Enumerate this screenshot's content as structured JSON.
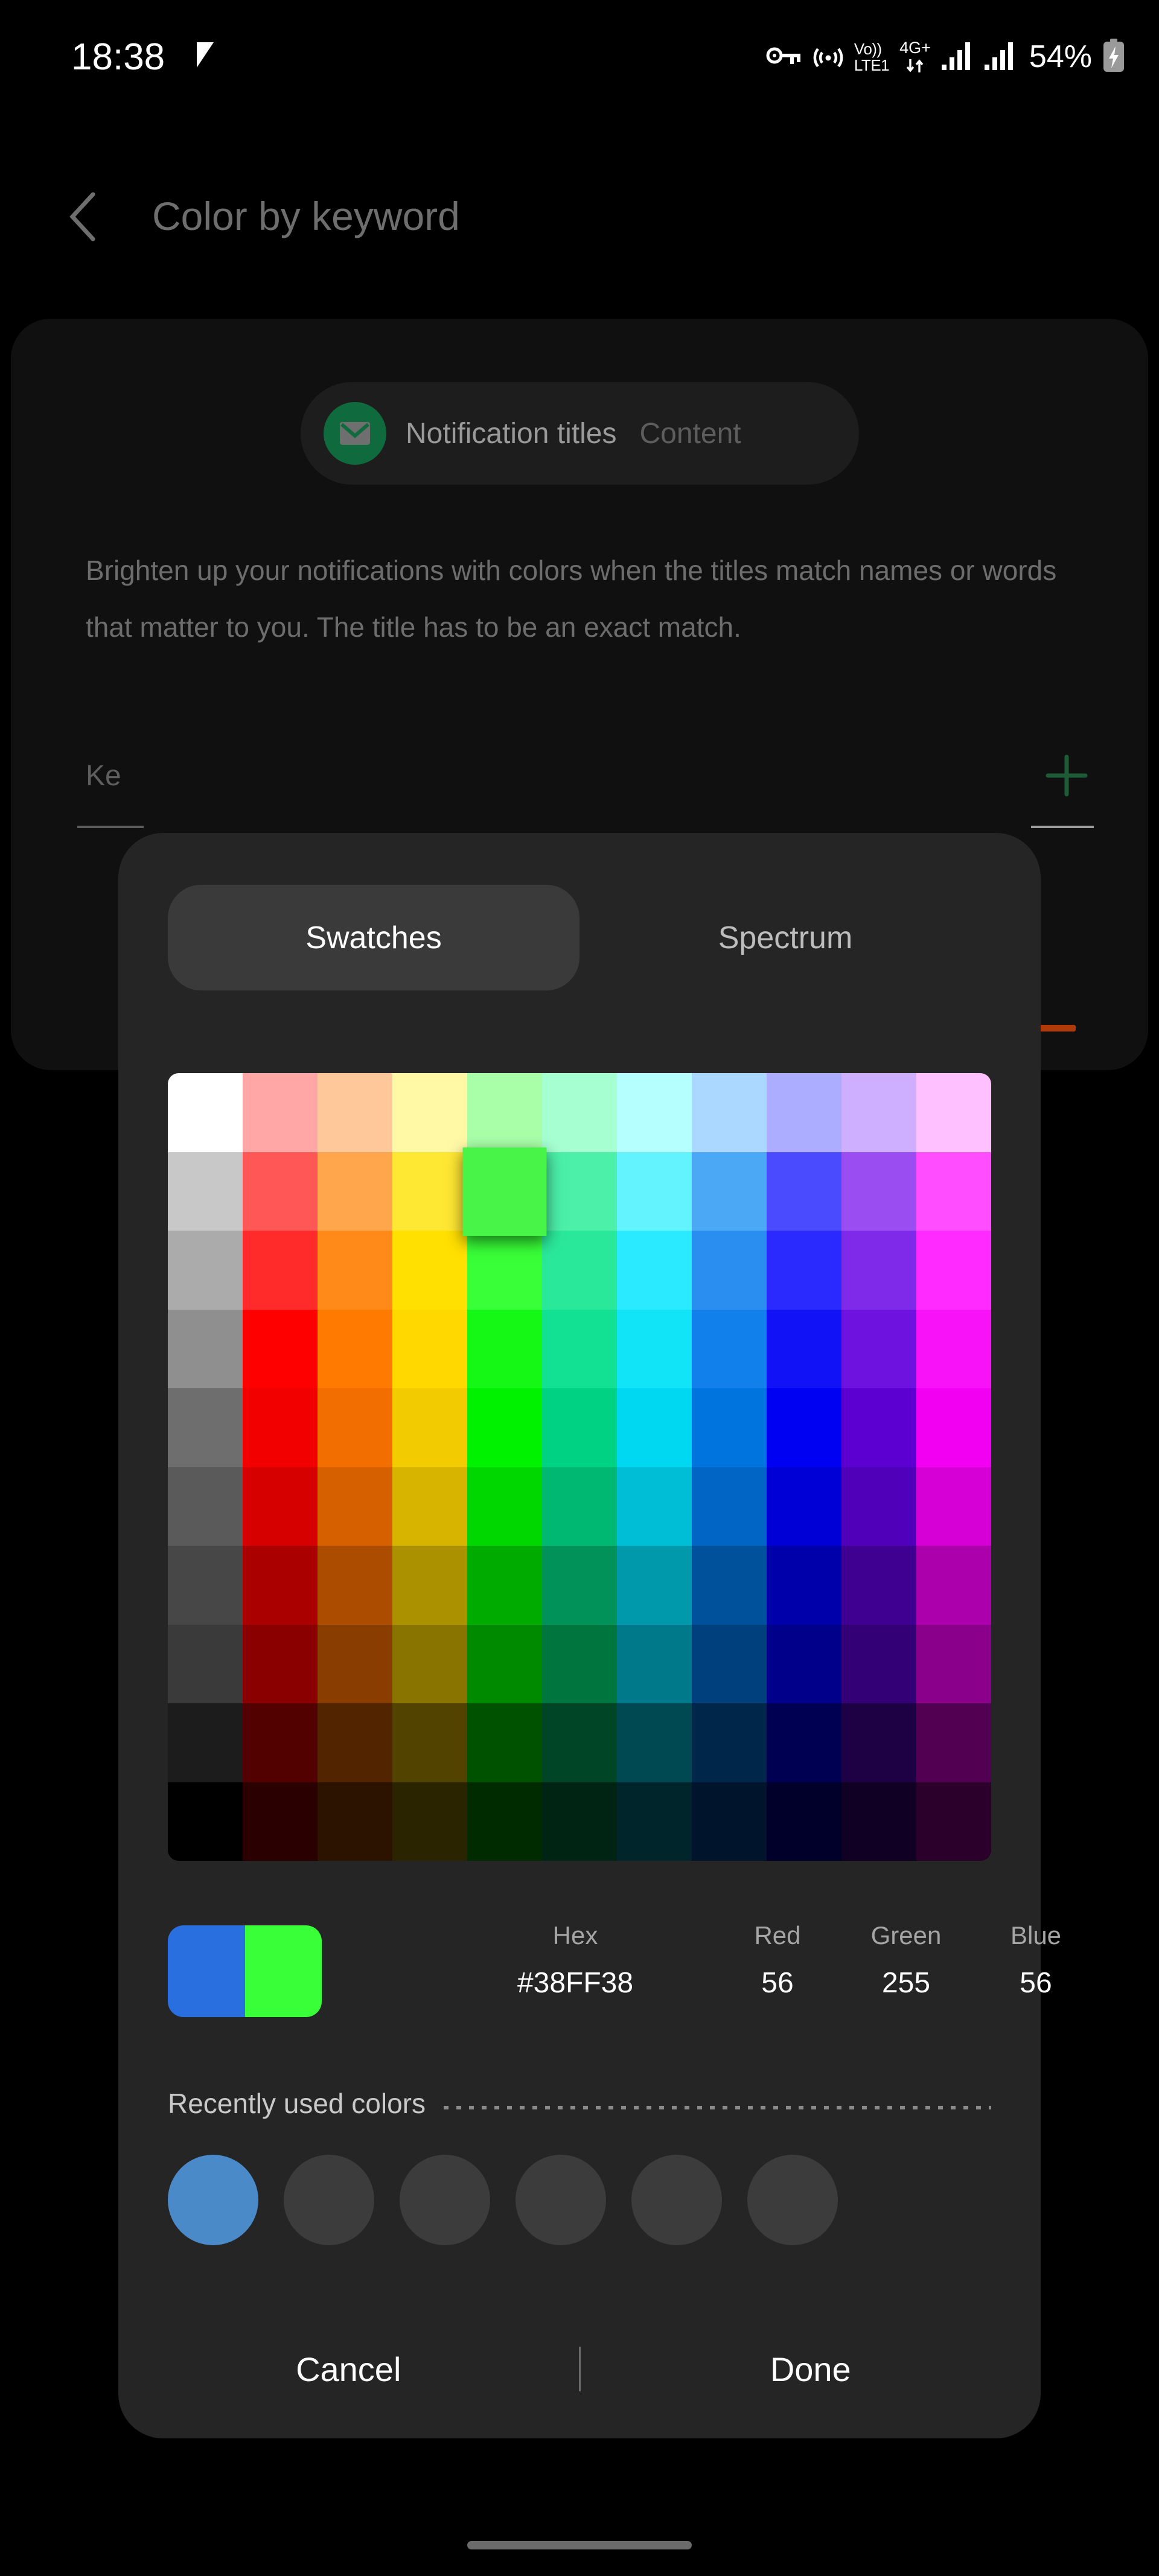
{
  "status_bar": {
    "clock": "18:38",
    "check_icon": "checkmark-icon",
    "vpn_icon": "vpn-key-icon",
    "hotspot_icon": "hotspot-icon",
    "volte_line1": "Vo))",
    "volte_line2": "LTE1",
    "network_type": "4G+",
    "data_arrows_icon": "data-transfer-arrows-icon",
    "signal1_icon": "signal-bars-icon",
    "signal2_icon": "signal-bars-icon",
    "battery_percent": "54%",
    "battery_icon": "battery-charging-icon"
  },
  "header": {
    "back_icon": "chevron-left-icon",
    "title": "Color by keyword"
  },
  "card": {
    "mail_icon": "mail-icon",
    "tab_titles": "Notification titles",
    "tab_content": "Content",
    "description": "Brighten up your notifications with colors when the titles match names or words that matter to you. The title has to be an exact match.",
    "keyword_label": "Ke",
    "add_icon": "plus-icon"
  },
  "dialog": {
    "tabs": [
      {
        "label": "Swatches",
        "selected": true
      },
      {
        "label": "Spectrum",
        "selected": false
      }
    ],
    "value_row": {
      "preview_old_color": "#2a6fe0",
      "preview_new_color": "#38FF38",
      "columns": [
        {
          "label": "Hex",
          "value": "#38FF38"
        },
        {
          "label": "Red",
          "value": "56"
        },
        {
          "label": "Green",
          "value": "255"
        },
        {
          "label": "Blue",
          "value": "56"
        }
      ]
    },
    "recent": {
      "label": "Recently used colors",
      "colors": [
        "#4a8ac9",
        null,
        null,
        null,
        null,
        null
      ]
    },
    "footer": {
      "cancel_label": "Cancel",
      "done_label": "Done"
    }
  },
  "swatch_grid": {
    "columns": 11,
    "rows": 10,
    "selected_index": 15,
    "colors": [
      "#ffffff",
      "#ffa7a7",
      "#ffc89a",
      "#fff9a6",
      "#a8ffa8",
      "#a5ffd0",
      "#b5ffff",
      "#abd8ff",
      "#adadff",
      "#ceaeff",
      "#ffc0ff",
      "#c8c8c8",
      "#ff5656",
      "#ffa64d",
      "#ffe834",
      "#49f449",
      "#4cf0a8",
      "#62f3ff",
      "#4aa8f5",
      "#4a4aff",
      "#9a4df0",
      "#ff4dff",
      "#ababab",
      "#ff2a2a",
      "#ff8a1a",
      "#ffe000",
      "#38ff38",
      "#2ae89a",
      "#2aeaff",
      "#2a8ef0",
      "#2a2aff",
      "#7f2ae8",
      "#ff2aff",
      "#8f8f8f",
      "#ff0000",
      "#ff7a00",
      "#ffd800",
      "#15f715",
      "#12e092",
      "#12e4f7",
      "#1280ea",
      "#1212f7",
      "#6e12e0",
      "#f712f7",
      "#6e6e6e",
      "#f20000",
      "#f26e00",
      "#f2cc00",
      "#00f200",
      "#00d284",
      "#00d8f2",
      "#0074de",
      "#0000f2",
      "#5c00d2",
      "#f200f2",
      "#5a5a5a",
      "#d60000",
      "#d65f00",
      "#d6b400",
      "#00d600",
      "#00b872",
      "#00bed6",
      "#0065c4",
      "#0000d6",
      "#5000b8",
      "#d600d6",
      "#474747",
      "#ab0000",
      "#ab4c00",
      "#ab9000",
      "#00ab00",
      "#009259",
      "#0098ab",
      "#00519c",
      "#0000ab",
      "#3f0092",
      "#ab00ab",
      "#3a3a3a",
      "#8a0000",
      "#8a3d00",
      "#8a7400",
      "#008a00",
      "#00763f",
      "#007a8a",
      "#00417d",
      "#00008a",
      "#330076",
      "#8a008a",
      "#1c1c1c",
      "#520000",
      "#522400",
      "#524400",
      "#005200",
      "#004526",
      "#004852",
      "#002649",
      "#000052",
      "#1e0045",
      "#520052",
      "#000000",
      "#2b0000",
      "#2b1300",
      "#2b2400",
      "#002b00",
      "#002414",
      "#00252b",
      "#00142b",
      "#00002b",
      "#0f0024",
      "#2b002b"
    ]
  }
}
